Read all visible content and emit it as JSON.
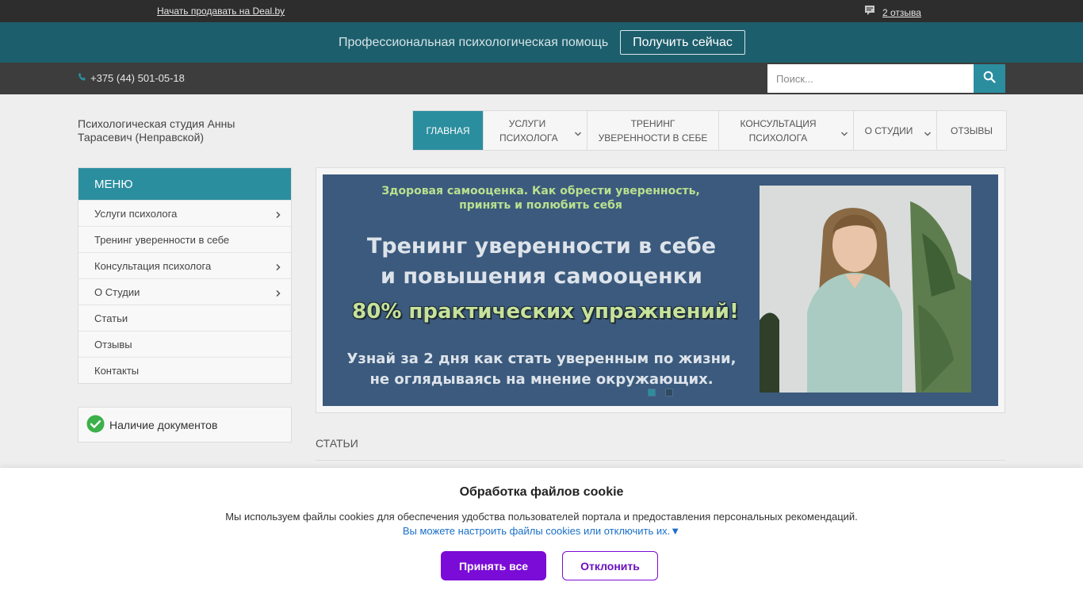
{
  "topbar": {
    "sell_link": "Начать продавать на Deal.by",
    "reviews_link": "2 отзыва"
  },
  "promo": {
    "text": "Профессиональная психологическая помощь",
    "button": "Получить сейчас"
  },
  "infobar": {
    "phone": "+375 (44) 501-05-18",
    "search_placeholder": "Поиск..."
  },
  "company_name": "Психологическая студия Анны Тарасевич (Неправской)",
  "nav": {
    "items": [
      {
        "label": "Главная"
      },
      {
        "label": "Услуги психолога"
      },
      {
        "label": "Тренинг уверенности в себе"
      },
      {
        "label": "Консультация психолога"
      },
      {
        "label": "О студии"
      },
      {
        "label": "Отзывы"
      }
    ]
  },
  "sidemenu": {
    "title": "Меню",
    "items": [
      {
        "label": "Услуги психолога"
      },
      {
        "label": "Тренинг уверенности в себе"
      },
      {
        "label": "Консультация психолога"
      },
      {
        "label": "О Студии"
      },
      {
        "label": "Статьи"
      },
      {
        "label": "Отзывы"
      },
      {
        "label": "Контакты"
      }
    ]
  },
  "docs_label": "Наличие документов",
  "banner": {
    "subtitle_line1": "Здоровая самооценка. Как обрести уверенность,",
    "subtitle_line2": "принять и полюбить себя",
    "title_line1": "Тренинг уверенности в себе",
    "title_line2": "и повышения самооценки",
    "badge": "80% практических упражнений!",
    "text_line1": "Узнай за 2 дня как стать уверенным по жизни,",
    "text_line2": "не оглядываясь на мнение окружающих."
  },
  "articles_title": "Статьи",
  "cookie": {
    "title": "Обработка файлов cookie",
    "text": "Мы используем файлы cookies для обеспечения удобства пользователей портала и предоставления персональных рекомендаций.",
    "link": "Вы можете настроить файлы cookies или отключить их.▼",
    "accept": "Принять все",
    "decline": "Отклонить"
  },
  "colors": {
    "accent": "#2b8e9f",
    "promo_bg": "#1d5e6c",
    "cookie_button": "#7b0bd6",
    "banner_bg": "#3b5a7d"
  },
  "icons": [
    "speech-bubble-icon",
    "phone-icon",
    "search-icon",
    "chevron-down-icon",
    "chevron-right-icon",
    "check-circle-icon"
  ]
}
